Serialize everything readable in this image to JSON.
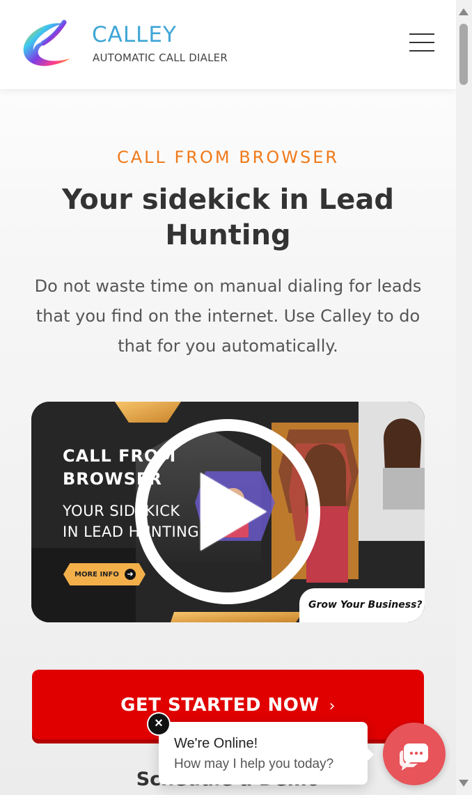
{
  "colors": {
    "accent_orange": "#f07a1a",
    "cta_red": "#e00000",
    "brand_blue": "#3fa6d6",
    "chat_red": "#e7545a"
  },
  "header": {
    "brand_name": "CALLEY",
    "brand_tagline": "AUTOMATIC CALL DIALER",
    "logo_icon": "calley-swirl-logo",
    "menu_icon": "hamburger-menu-icon"
  },
  "hero": {
    "eyebrow": "CALL FROM BROWSER",
    "headline_regular": "Your sidekick in ",
    "headline_bold": "Lead Hunting",
    "lead_text": "Do not waste time on manual dialing for leads that you find on the internet. Use Calley to do that for you automatically."
  },
  "video": {
    "title_line1": "CALL FROM",
    "title_line2": "BROWSER",
    "sub_line1": "YOUR SIDEKICK",
    "sub_line2": "IN LEAD HUNTING",
    "more_info": "MORE INFO",
    "tagline": "Grow Your Business?",
    "play_icon": "play-icon"
  },
  "cta": {
    "label": "GET STARTED NOW",
    "chevron": "›"
  },
  "schedule": {
    "label": "Schedule a Demo"
  },
  "chat": {
    "title": "We're Online!",
    "subtitle": "How may I help you today?",
    "close_glyph": "×",
    "launcher_icon": "chat-bubble-icon"
  }
}
